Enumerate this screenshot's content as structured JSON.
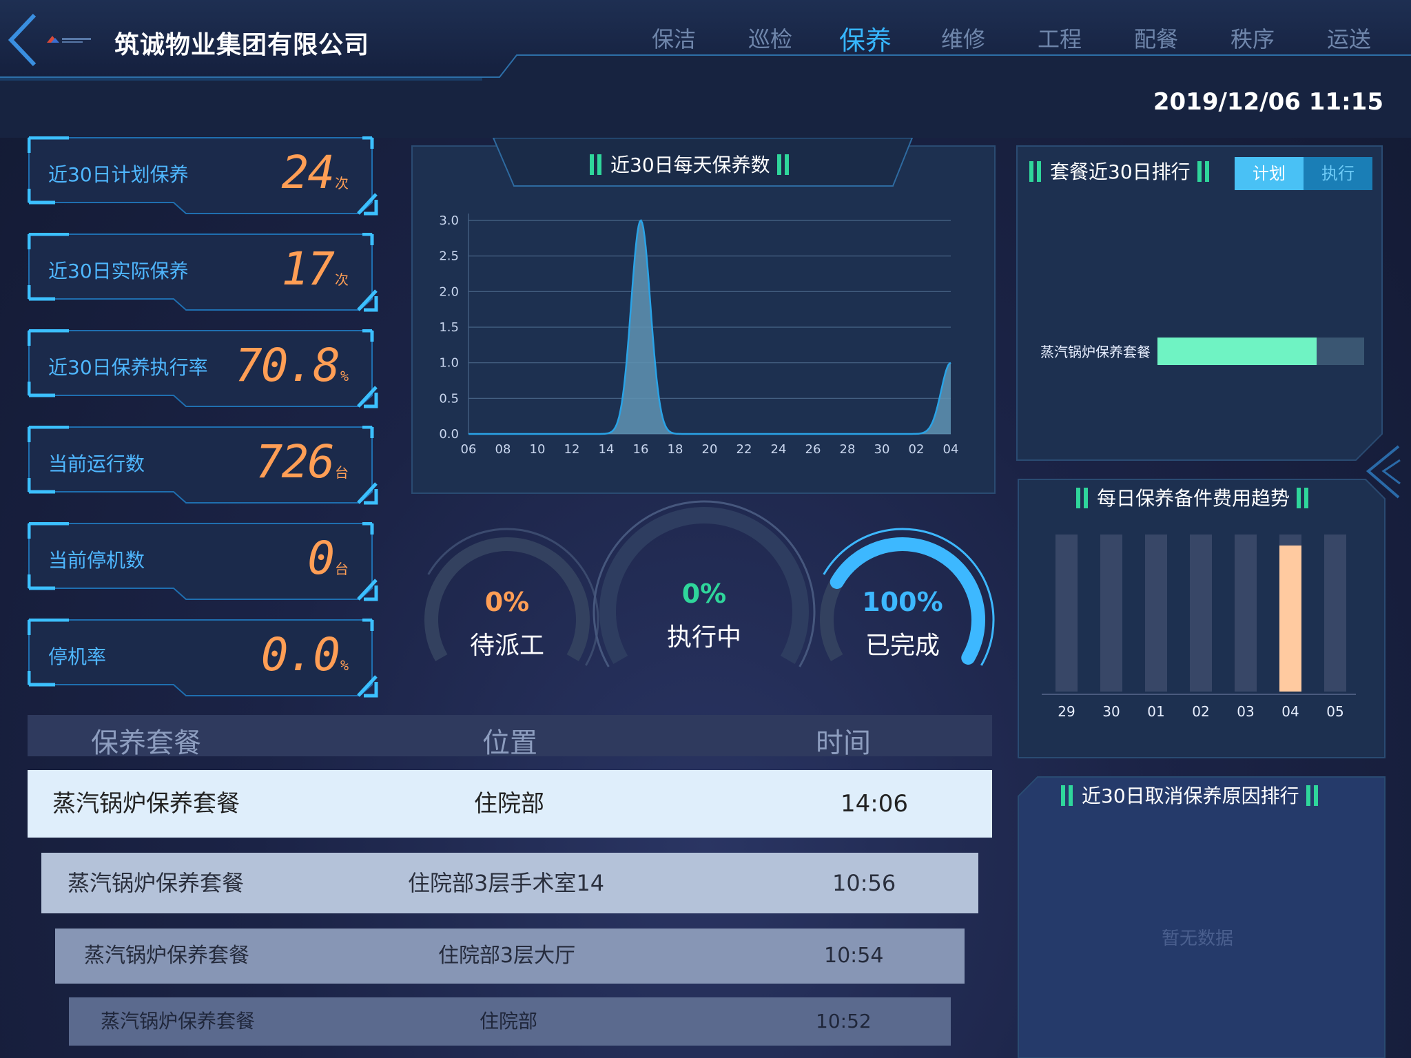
{
  "header": {
    "company": "筑诚物业集团有限公司",
    "datetime": "2019/12/06 11:15",
    "tabs": [
      {
        "label": "保洁",
        "active": false
      },
      {
        "label": "巡检",
        "active": false
      },
      {
        "label": "保养",
        "active": true
      },
      {
        "label": "维修",
        "active": false
      },
      {
        "label": "工程",
        "active": false
      },
      {
        "label": "配餐",
        "active": false
      },
      {
        "label": "秩序",
        "active": false
      },
      {
        "label": "运送",
        "active": false
      }
    ]
  },
  "stats": [
    {
      "label": "近30日计划保养",
      "value": "24",
      "unit": "次"
    },
    {
      "label": "近30日实际保养",
      "value": "17",
      "unit": "次"
    },
    {
      "label": "近30日保养执行率",
      "value": "70.8",
      "unit": "%"
    },
    {
      "label": "当前运行数",
      "value": "726",
      "unit": "台"
    },
    {
      "label": "当前停机数",
      "value": "0",
      "unit": "台"
    },
    {
      "label": "停机率",
      "value": "0.0",
      "unit": "%"
    }
  ],
  "daily_chart": {
    "title": "近30日每天保养数",
    "chart_data": {
      "type": "area",
      "x": [
        "06",
        "08",
        "10",
        "12",
        "14",
        "16",
        "18",
        "20",
        "22",
        "24",
        "26",
        "28",
        "30",
        "02",
        "04"
      ],
      "values": [
        0,
        0,
        0,
        0,
        0,
        3,
        0,
        0,
        0,
        0,
        0,
        0,
        0,
        0,
        1
      ],
      "ylim": [
        0,
        3.0
      ],
      "yticks": [
        "0.0",
        "0.5",
        "1.0",
        "1.5",
        "2.0",
        "2.5",
        "3.0"
      ],
      "grid": true,
      "colors": {
        "fill": "#5f93b3",
        "stroke": "#2aa3e6"
      }
    }
  },
  "gauges": [
    {
      "value": "0%",
      "label": "待派工",
      "fraction": 0,
      "color": "#ff9e55"
    },
    {
      "value": "0%",
      "label": "执行中",
      "fraction": 0,
      "color": "#2fd69b"
    },
    {
      "value": "100%",
      "label": "已完成",
      "fraction": 1,
      "color": "#3db8ff"
    }
  ],
  "table": {
    "headers": [
      "保养套餐",
      "位置",
      "时间"
    ],
    "rows": [
      {
        "pkg": "蒸汽锅炉保养套餐",
        "loc": "住院部",
        "time": "14:06"
      },
      {
        "pkg": "蒸汽锅炉保养套餐",
        "loc": "住院部3层手术室14",
        "time": "10:56"
      },
      {
        "pkg": "蒸汽锅炉保养套餐",
        "loc": "住院部3层大厅",
        "time": "10:54"
      },
      {
        "pkg": "蒸汽锅炉保养套餐",
        "loc": "住院部",
        "time": "10:52"
      }
    ]
  },
  "ranking": {
    "title": "套餐近30日排行",
    "toggle": [
      {
        "label": "计划",
        "active": true
      },
      {
        "label": "执行",
        "active": false
      }
    ],
    "chart_data": {
      "type": "bar",
      "orientation": "horizontal",
      "categories": [
        "蒸汽锅炉保养套餐"
      ],
      "values": [
        0.77
      ],
      "colors": {
        "bar": "#6ff3c3",
        "track": "#3a5672"
      }
    }
  },
  "cost_chart": {
    "title": "每日保养备件费用趋势",
    "chart_data": {
      "type": "bar",
      "categories": [
        "29",
        "30",
        "01",
        "02",
        "03",
        "04",
        "05"
      ],
      "values": [
        0,
        0,
        0,
        0,
        0,
        0.93,
        0
      ],
      "colors": {
        "bar": "#ffcaa0",
        "track": "#384767"
      }
    }
  },
  "cancel_rank": {
    "title": "近30日取消保养原因排行",
    "empty": "暂无数据"
  }
}
